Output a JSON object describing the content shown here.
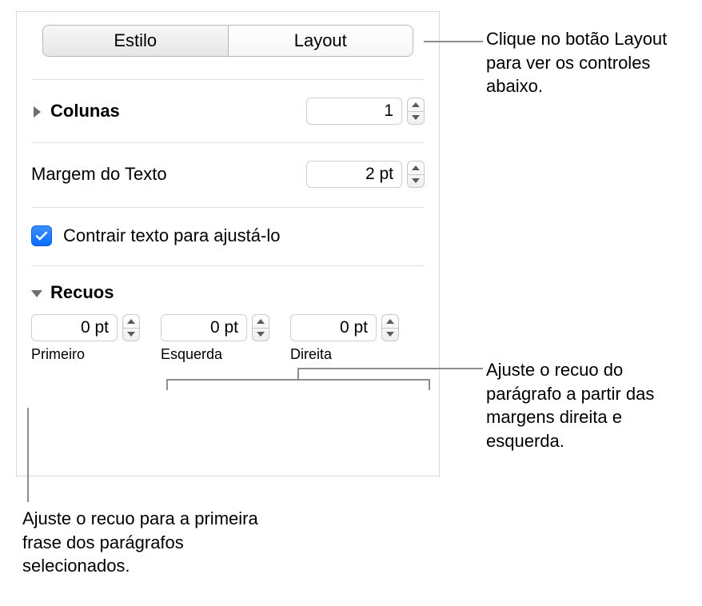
{
  "tabs": {
    "style": "Estilo",
    "layout": "Layout"
  },
  "columns": {
    "label": "Colunas",
    "value": "1"
  },
  "textMargin": {
    "label": "Margem do Texto",
    "value": "2 pt"
  },
  "shrink": {
    "label": "Contrair texto para ajustá-lo"
  },
  "indents": {
    "label": "Recuos",
    "first": {
      "value": "0 pt",
      "caption": "Primeiro"
    },
    "left": {
      "value": "0 pt",
      "caption": "Esquerda"
    },
    "right": {
      "value": "0 pt",
      "caption": "Direita"
    }
  },
  "callouts": {
    "layout": "Clique no botão Layout para ver os controles abaixo.",
    "lr": "Ajuste o recuo do parágrafo a partir das margens direita e esquerda.",
    "first": "Ajuste o recuo para a primeira frase dos parágrafos selecionados."
  }
}
